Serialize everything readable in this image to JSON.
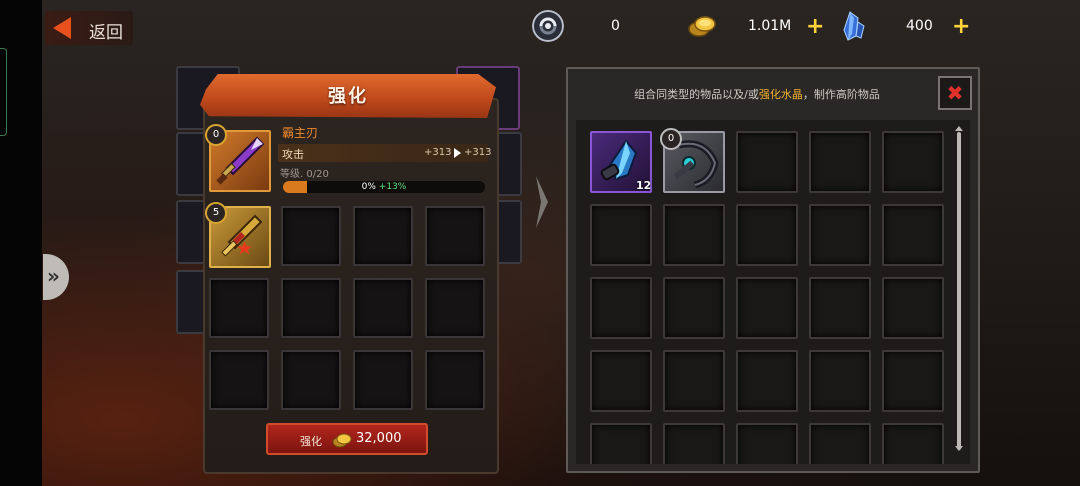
{
  "header": {
    "back_label": "返回",
    "resources": [
      {
        "name": "dark-orb",
        "value": "0",
        "has_plus": false
      },
      {
        "name": "gold-coins",
        "value": "1.01M",
        "has_plus": true
      },
      {
        "name": "blue-crystal",
        "value": "400",
        "has_plus": true
      }
    ]
  },
  "enhance": {
    "title": "强化",
    "item_name": "霸主刃",
    "item_level_badge": "0",
    "stat_label": "攻击",
    "stat_current": "+313",
    "stat_next": "+313",
    "level_text": "等级. 0/20",
    "progress_percent_text": "0%",
    "progress_gain_text": "+13%",
    "progress_fraction": 0.12,
    "material_level_badge": "5",
    "button_label": "强化",
    "cost": "32,000"
  },
  "combine": {
    "desc_before": "组合同类型的物品以及/或",
    "desc_highlight": "强化水晶",
    "desc_after": "，制作高阶物品",
    "items": [
      {
        "name": "enhance-crystal",
        "quantity": "12"
      },
      {
        "name": "dark-weapon",
        "level_badge": "0"
      }
    ]
  },
  "colors": {
    "accent": "#e8501e",
    "gold": "#ffd23a",
    "highlight": "#f0b02c",
    "close": "#e0312a"
  }
}
